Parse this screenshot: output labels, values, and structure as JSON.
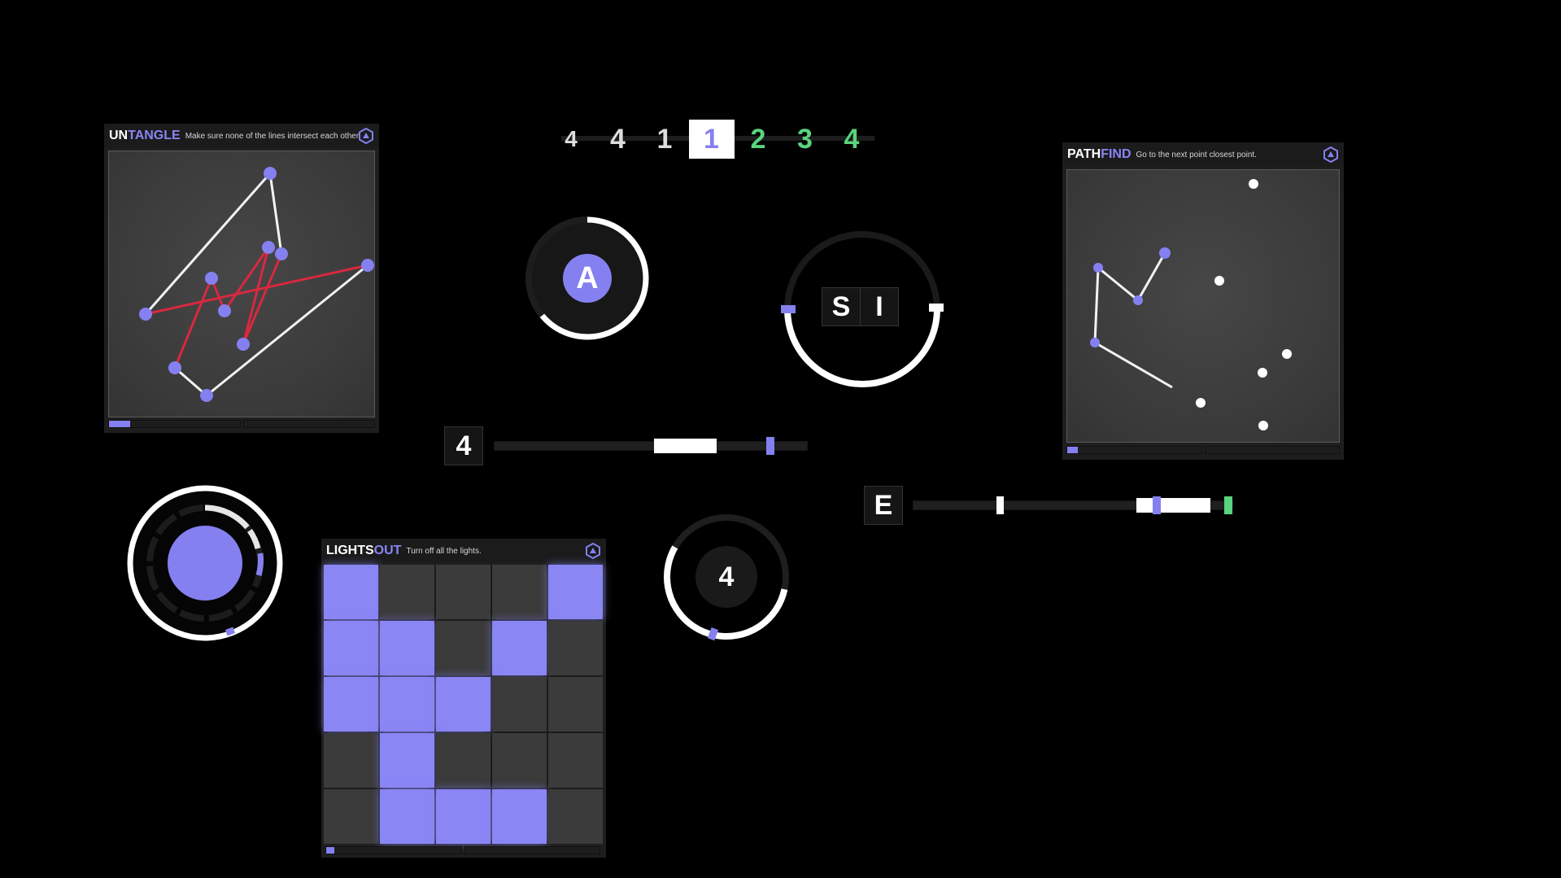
{
  "colors": {
    "accent": "#8580f0",
    "green": "#5ad47e",
    "red": "#d9283f",
    "panel": "#1e1e1e",
    "board": "#3c3c3c",
    "background": "#000000"
  },
  "untangle": {
    "title_part1": "UN",
    "title_part2": "TANGLE",
    "instruction": "Make sure none of the lines intersect each other.",
    "logo_icon": "hexagon-logo-icon",
    "progress": 0.08
  },
  "pathfind": {
    "title_part1": "PATH",
    "title_part2": "FIND",
    "instruction": "Go to the next point closest point.",
    "logo_icon": "hexagon-logo-icon",
    "progress": 0.04
  },
  "lightsout": {
    "title_part1": "LIGHTS",
    "title_part2": "OUT",
    "instruction": "Turn off all the lights.",
    "logo_icon": "hexagon-logo-icon",
    "progress": 0.03,
    "grid": [
      [
        1,
        0,
        0,
        0,
        1
      ],
      [
        1,
        1,
        0,
        1,
        0
      ],
      [
        1,
        1,
        1,
        0,
        0
      ],
      [
        0,
        1,
        0,
        0,
        0
      ],
      [
        0,
        1,
        1,
        1,
        0
      ]
    ]
  },
  "sequence": {
    "digits": [
      {
        "value": "4",
        "state": "done"
      },
      {
        "value": "4",
        "state": "done"
      },
      {
        "value": "1",
        "state": "done"
      },
      {
        "value": "1",
        "state": "active"
      },
      {
        "value": "2",
        "state": "upcoming"
      },
      {
        "value": "3",
        "state": "upcoming"
      },
      {
        "value": "4",
        "state": "upcoming"
      }
    ]
  },
  "ring_letter": {
    "label": "A",
    "progress": 0.64
  },
  "ring_si": {
    "letters": [
      "S",
      "I"
    ]
  },
  "slider_4": {
    "label": "4",
    "target_start": 0.51,
    "target_end": 0.71,
    "marker": 0.87
  },
  "slider_e": {
    "label": "E",
    "marker_white": 0.26,
    "target_start": 0.7,
    "target_end": 0.93,
    "marker_accent": 0.75,
    "marker_green": 1.0
  },
  "ring_number": {
    "label": "4",
    "progress": 0.55
  },
  "ring_core": {
    "progress": 0.95
  }
}
